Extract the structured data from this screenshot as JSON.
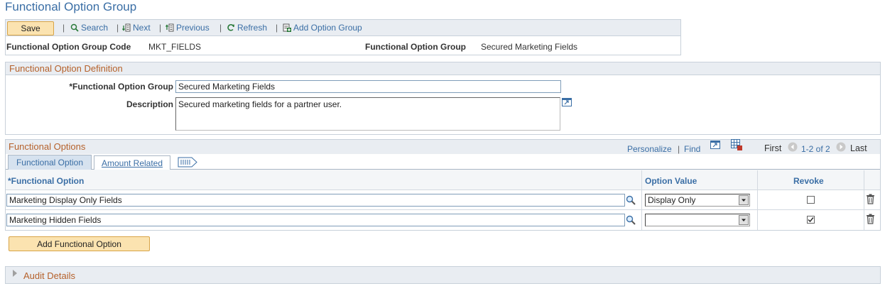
{
  "page": {
    "title": "Functional Option Group"
  },
  "toolbar": {
    "save_label": "Save",
    "search_label": "Search",
    "next_label": "Next",
    "previous_label": "Previous",
    "refresh_label": "Refresh",
    "add_group_label": "Add Option Group",
    "separator": "|"
  },
  "header": {
    "code_label": "Functional Option Group Code",
    "code_value": "MKT_FIELDS",
    "group_label": "Functional Option Group",
    "group_value": "Secured Marketing Fields"
  },
  "definition": {
    "title": "Functional Option Definition",
    "group_label": "*Functional Option Group",
    "group_value": "Secured Marketing Fields",
    "description_label": "Description",
    "description_value": "Secured marketing fields for a partner user."
  },
  "options": {
    "title": "Functional Options",
    "personalize": "Personalize",
    "pipe": "|",
    "find": "Find",
    "first": "First",
    "range": "1-2 of 2",
    "last": "Last",
    "tabs": [
      {
        "label": "Functional Option"
      },
      {
        "label": "Amount Related"
      }
    ],
    "columns": {
      "option": "*Functional Option",
      "value": "Option Value",
      "revoke": "Revoke"
    },
    "rows": [
      {
        "option": "Marketing Display Only Fields",
        "value": "Display Only",
        "revoke": false
      },
      {
        "option": "Marketing Hidden Fields",
        "value": "",
        "revoke": true
      }
    ],
    "add_label": "Add Functional Option"
  },
  "audit": {
    "title": "Audit Details"
  },
  "colors": {
    "link": "#3a6ea5",
    "section_title": "#b5612b",
    "button": "#fbe3b0",
    "header_bg": "#e9edf2"
  }
}
